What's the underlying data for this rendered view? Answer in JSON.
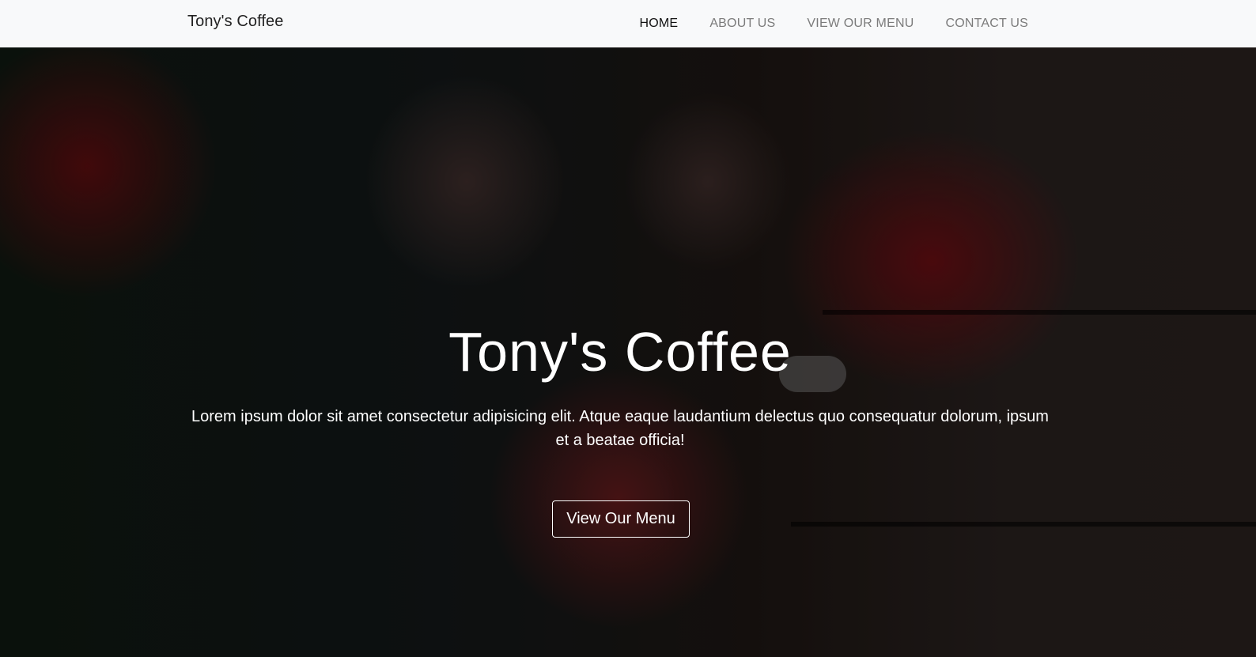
{
  "navbar": {
    "brand": "Tony's Coffee",
    "links": [
      {
        "label": "HOME",
        "active": true
      },
      {
        "label": "ABOUT US",
        "active": false
      },
      {
        "label": "VIEW OUR MENU",
        "active": false
      },
      {
        "label": "CONTACT US",
        "active": false
      }
    ]
  },
  "hero": {
    "title": "Tony's Coffee",
    "text": "Lorem ipsum dolor sit amet consectetur adipisicing elit. Atque eaque laudantium delectus quo consequatur dolorum, ipsum et a beatae officia!",
    "button_label": "View Our Menu"
  },
  "colors": {
    "navbar_bg": "#f8f9fa",
    "nav_active": "#111111",
    "nav_inactive": "#7b7b7b",
    "hero_text": "#ffffff"
  }
}
